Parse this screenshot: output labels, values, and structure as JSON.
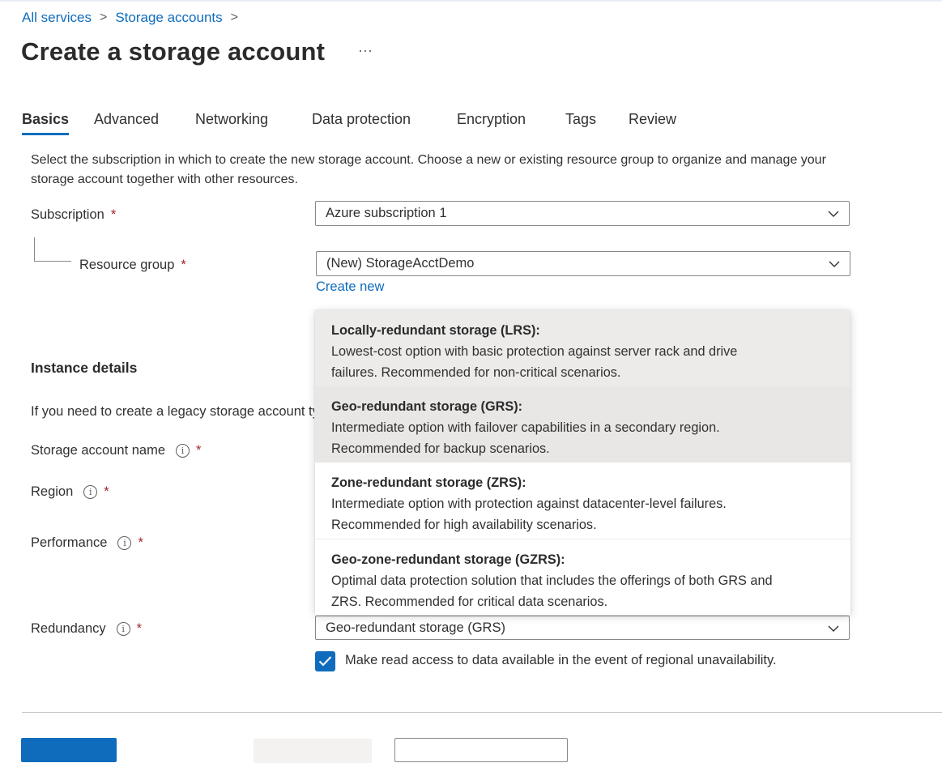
{
  "breadcrumb": {
    "items": [
      "All services",
      "Storage accounts"
    ],
    "sep": ">"
  },
  "page": {
    "title": "Create a storage account",
    "more": "···"
  },
  "tabs": [
    "Basics",
    "Advanced",
    "Networking",
    "Data protection",
    "Encryption",
    "Tags",
    "Review"
  ],
  "intro": {
    "text": "Select the subscription in which to create the new storage account. Choose a new or existing resource group to organize and manage your storage account together with other resources."
  },
  "form": {
    "subscription": {
      "label": "Subscription",
      "value": "Azure subscription 1"
    },
    "resource_group": {
      "label": "Resource group",
      "value": "(New) StorageAcctDemo",
      "create_new": "Create new"
    },
    "required_mark": "*",
    "info_glyph": "i",
    "instance_details": "Instance details",
    "legacy_text": "If you need to create a legacy storage account type, please click here.",
    "storage_account_name": {
      "label": "Storage account name"
    },
    "region": {
      "label": "Region"
    },
    "performance": {
      "label": "Performance"
    },
    "redundancy": {
      "label": "Redundancy",
      "value": "Geo-redundant storage (GRS)",
      "options": [
        {
          "title": "Locally-redundant storage (LRS):",
          "line1": "Lowest-cost option with basic protection against server rack and drive",
          "line2": "failures. Recommended for non-critical scenarios."
        },
        {
          "title": "Geo-redundant storage (GRS):",
          "line1": "Intermediate option with failover capabilities in a secondary region.",
          "line2": "Recommended for backup scenarios."
        },
        {
          "title": "Zone-redundant storage (ZRS):",
          "line1": "Intermediate option with protection against datacenter-level failures.",
          "line2": "Recommended for high availability scenarios."
        },
        {
          "title": "Geo-zone-redundant storage (GZRS):",
          "line1": "Optimal data protection solution that includes the offerings of both GRS and",
          "line2": "ZRS. Recommended for critical data scenarios."
        }
      ]
    },
    "read_access": {
      "label": "Make read access to data available in the event of regional unavailability.",
      "checked": true
    }
  },
  "colors": {
    "accent": "#0f6cbd",
    "required": "#a4262c",
    "hover": "#ecebea"
  },
  "icons": [
    "chevron-down-icon",
    "info-icon",
    "checkmark-icon",
    "ellipsis-icon",
    "chevron-right-icon"
  ]
}
